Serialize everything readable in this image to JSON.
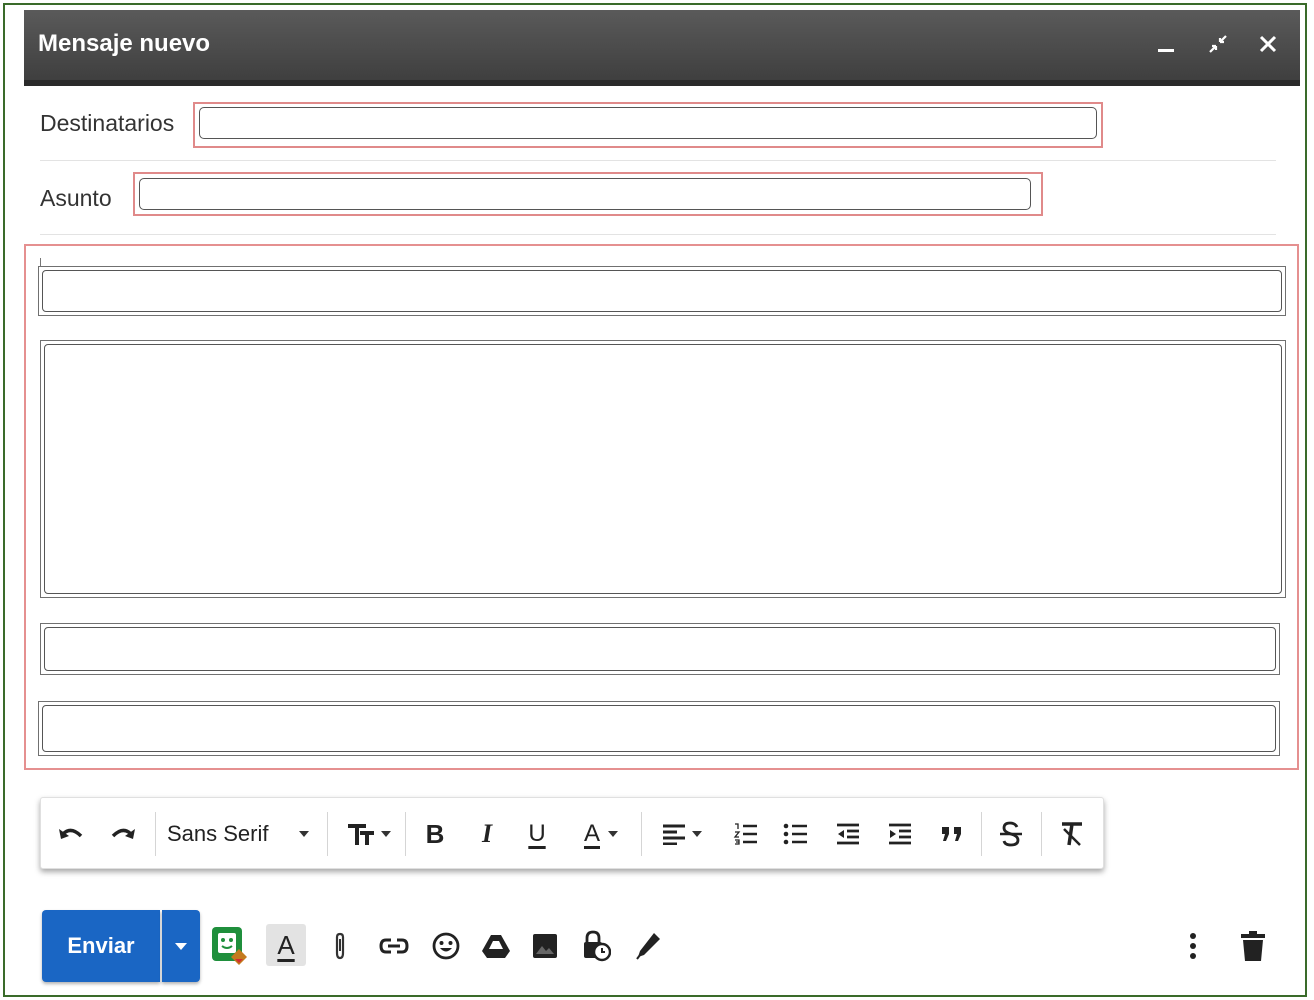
{
  "window": {
    "title": "Mensaje nuevo",
    "minimize_icon": "minimize-icon",
    "expand_icon": "fullscreen-icon",
    "close_icon": "close-icon"
  },
  "recipients": {
    "label": "Destinatarios",
    "value": ""
  },
  "subject": {
    "label": "Asunto",
    "value": ""
  },
  "toolbar": {
    "font_name": "Sans Serif",
    "bold_label": "B",
    "italic_label": "I",
    "underline_label": "U",
    "text_color_label": "A"
  },
  "footer": {
    "send_label": "Enviar",
    "format_label": "A",
    "accent_color": "#1a66c4"
  }
}
